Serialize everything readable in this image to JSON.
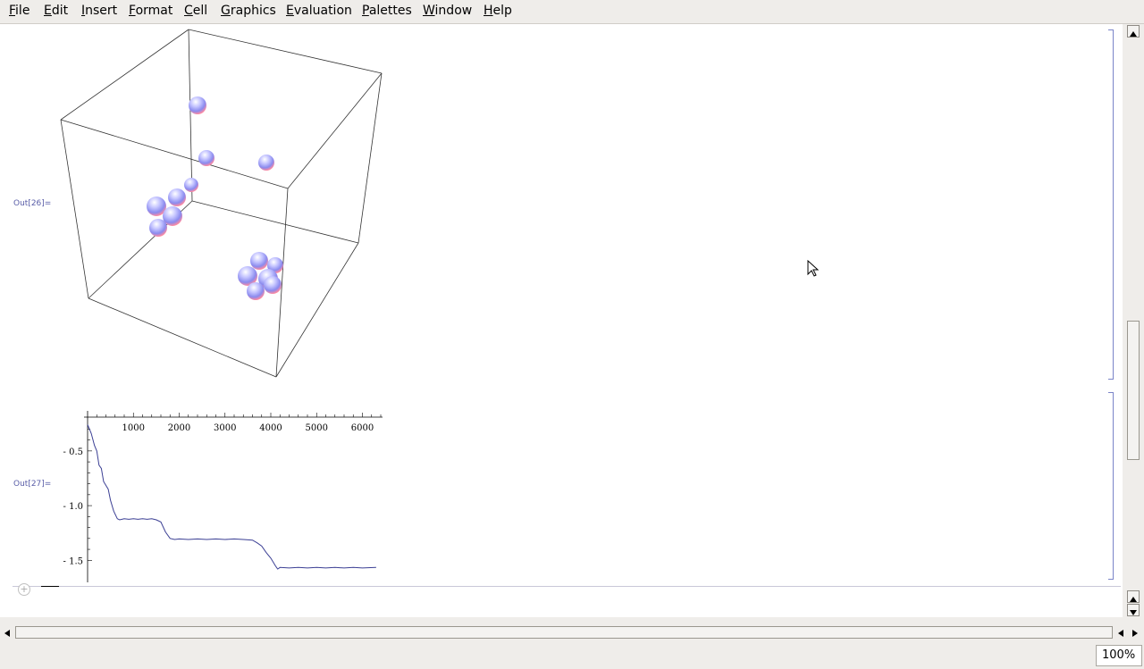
{
  "menubar": {
    "items": [
      {
        "label": "File",
        "key": "F",
        "rest": "ile"
      },
      {
        "label": "Edit",
        "key": "E",
        "rest": "dit"
      },
      {
        "label": "Insert",
        "key": "I",
        "rest": "nsert"
      },
      {
        "label": "Format",
        "key": "F",
        "rest": "ormat"
      },
      {
        "label": "Cell",
        "key": "C",
        "rest": "ell"
      },
      {
        "label": "Graphics",
        "key": "G",
        "rest": "raphics"
      },
      {
        "label": "Evaluation",
        "key": "E",
        "rest": "valuation"
      },
      {
        "label": "Palettes",
        "key": "P",
        "rest": "alettes"
      },
      {
        "label": "Window",
        "key": "W",
        "rest": "indow"
      },
      {
        "label": "Help",
        "key": "H",
        "rest": "elp"
      }
    ]
  },
  "cells": {
    "out26": {
      "label": "Out[26]="
    },
    "out27": {
      "label": "Out[27]="
    }
  },
  "colors": {
    "accent": "#5a5ea8",
    "plot_line": "#3b3f94",
    "sphere_top": "#c8c8ff",
    "sphere_bottom": "#ff9aa8"
  },
  "status": {
    "zoom": "100%"
  },
  "chart_data": {
    "type": "line",
    "xlim": [
      0,
      6400
    ],
    "ylim": [
      -1.62,
      -0.15
    ],
    "xticks": [
      "1000",
      "2000",
      "3000",
      "4000",
      "5000",
      "6000"
    ],
    "yticks": [
      "- 0.5",
      "- 1.0",
      "- 1.5"
    ],
    "series": [
      {
        "values_xy": [
          [
            0,
            -0.26
          ],
          [
            80,
            -0.34
          ],
          [
            150,
            -0.45
          ],
          [
            200,
            -0.5
          ],
          [
            250,
            -0.63
          ],
          [
            300,
            -0.66
          ],
          [
            350,
            -0.78
          ],
          [
            450,
            -0.85
          ],
          [
            500,
            -0.95
          ],
          [
            570,
            -1.05
          ],
          [
            650,
            -1.12
          ],
          [
            700,
            -1.13
          ],
          [
            800,
            -1.12
          ],
          [
            900,
            -1.125
          ],
          [
            1000,
            -1.12
          ],
          [
            1100,
            -1.125
          ],
          [
            1200,
            -1.12
          ],
          [
            1300,
            -1.125
          ],
          [
            1400,
            -1.12
          ],
          [
            1500,
            -1.13
          ],
          [
            1600,
            -1.15
          ],
          [
            1700,
            -1.24
          ],
          [
            1800,
            -1.3
          ],
          [
            1900,
            -1.31
          ],
          [
            2000,
            -1.305
          ],
          [
            2200,
            -1.31
          ],
          [
            2400,
            -1.305
          ],
          [
            2600,
            -1.31
          ],
          [
            2800,
            -1.305
          ],
          [
            3000,
            -1.31
          ],
          [
            3200,
            -1.305
          ],
          [
            3400,
            -1.31
          ],
          [
            3600,
            -1.315
          ],
          [
            3700,
            -1.34
          ],
          [
            3800,
            -1.37
          ],
          [
            3900,
            -1.43
          ],
          [
            4000,
            -1.48
          ],
          [
            4100,
            -1.55
          ],
          [
            4150,
            -1.58
          ],
          [
            4200,
            -1.565
          ],
          [
            4400,
            -1.57
          ],
          [
            4600,
            -1.565
          ],
          [
            4800,
            -1.57
          ],
          [
            5000,
            -1.565
          ],
          [
            5200,
            -1.57
          ],
          [
            5400,
            -1.565
          ],
          [
            5600,
            -1.57
          ],
          [
            5800,
            -1.565
          ],
          [
            6000,
            -1.57
          ],
          [
            6300,
            -1.565
          ]
        ]
      }
    ]
  }
}
